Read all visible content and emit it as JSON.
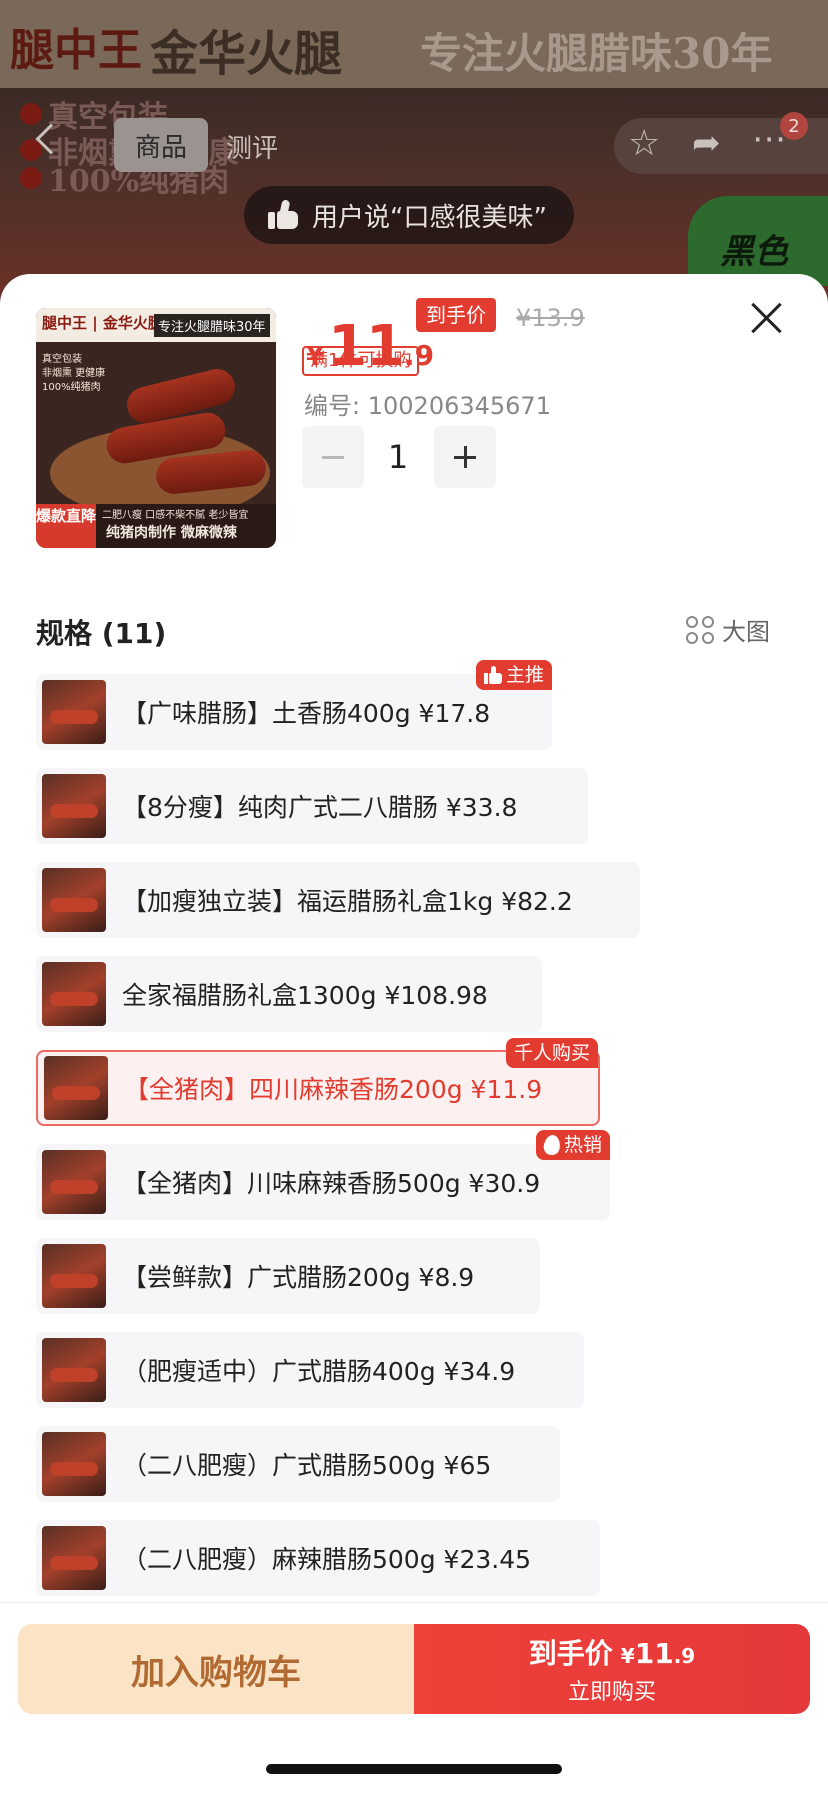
{
  "background": {
    "banner_logo": "腿中王",
    "banner_brand": "金华火腿",
    "banner_slogan": "专注火腿腊味30年",
    "features": [
      "真空包装",
      "非烟熏 更健康",
      "100%纯猪肉"
    ],
    "green_tag": "黑色",
    "nav": {
      "tab_product": "商品",
      "tab_review": "测评",
      "badge_count": "2"
    },
    "review_text": "用户说“口感很美味”"
  },
  "product": {
    "thumb": {
      "logo": "腿中王 | 金华火腿",
      "slogan": "专注火腿腊味30年",
      "features": [
        "真空包装",
        "非烟熏 更健康",
        "100%纯猪肉"
      ],
      "badge": "爆款直降",
      "bottom_line1": "二肥八瘦 口感不柴不腻 老少皆宜",
      "bottom_line2": "纯猪肉制作 微麻微辣"
    },
    "price_symbol": "¥",
    "price_int": "11",
    "price_dec": ".9",
    "price_tag": "到手价",
    "price_old": "¥13.9",
    "promo": "满1件可换购",
    "sku_label": "编号:",
    "sku_value": "100206345671",
    "quantity": "1"
  },
  "specs": {
    "title": "规格 (11)",
    "bigpic_label": "大图",
    "items": [
      {
        "label": "【广味腊肠】土香肠400g  ¥17.8",
        "tag": "主推",
        "tag_icon": "thumbs-up-icon"
      },
      {
        "label": "【8分瘦】纯肉广式二八腊肠  ¥33.8"
      },
      {
        "label": "【加瘦独立装】福运腊肠礼盒1kg  ¥82.2"
      },
      {
        "label": "全家福腊肠礼盒1300g  ¥108.98"
      },
      {
        "label": "【全猪肉】四川麻辣香肠200g  ¥11.9",
        "tag": "千人购买",
        "selected": true
      },
      {
        "label": "【全猪肉】川味麻辣香肠500g  ¥30.9",
        "tag": "热销",
        "tag_icon": "fire-icon"
      },
      {
        "label": "【尝鲜款】广式腊肠200g  ¥8.9"
      },
      {
        "label": "（肥瘦适中）广式腊肠400g  ¥34.9"
      },
      {
        "label": "（二八肥瘦）广式腊肠500g  ¥65"
      },
      {
        "label": "（二八肥瘦）麻辣腊肠500g  ¥23.45"
      }
    ]
  },
  "actions": {
    "add_to_cart": "加入购物车",
    "buy_price_label": "到手价",
    "buy_price_symbol": "¥",
    "buy_price_int": "11",
    "buy_price_dec": ".9",
    "buy_now": "立即购买"
  },
  "colors": {
    "accent": "#e23c30",
    "cart_bg": "#fbe3c6",
    "cart_text": "#b06a32"
  }
}
